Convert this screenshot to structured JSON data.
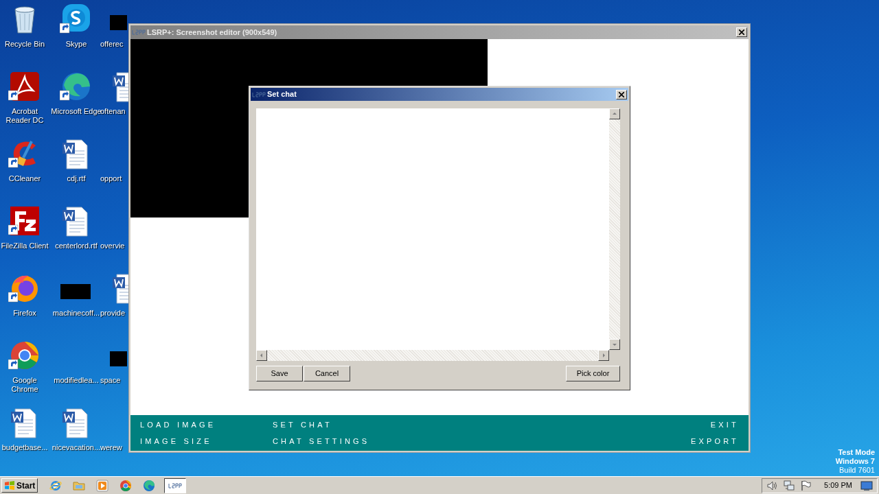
{
  "desktop": {
    "columns": [
      [
        {
          "label": "Recycle Bin",
          "kind": "recycle",
          "shortcut": false
        },
        {
          "label": "Acrobat Reader DC",
          "kind": "pdf",
          "shortcut": true
        },
        {
          "label": "CCleaner",
          "kind": "ccleaner",
          "shortcut": true
        },
        {
          "label": "FileZilla Client",
          "kind": "filezilla",
          "shortcut": true
        },
        {
          "label": "Firefox",
          "kind": "firefox",
          "shortcut": true
        },
        {
          "label": "Google Chrome",
          "kind": "chrome",
          "shortcut": true
        },
        {
          "label": "budgetbase...",
          "kind": "word",
          "shortcut": false
        }
      ],
      [
        {
          "label": "Skype",
          "kind": "skype",
          "shortcut": true
        },
        {
          "label": "Microsoft Edge",
          "kind": "edge",
          "shortcut": true
        },
        {
          "label": "cdj.rtf",
          "kind": "word",
          "shortcut": false
        },
        {
          "label": "centerlord.rtf",
          "kind": "word",
          "shortcut": false
        },
        {
          "label": "machinecoff...",
          "kind": "black",
          "shortcut": false
        },
        {
          "label": "modifiedlea...",
          "kind": "blank"
        },
        {
          "label": "nicevacation...",
          "kind": "word",
          "shortcut": false
        }
      ],
      [
        {
          "label": "offerec",
          "kind": "black",
          "shortcut": false
        },
        {
          "label": "oftenan",
          "kind": "word",
          "shortcut": false
        },
        {
          "label": "opport",
          "kind": "blank"
        },
        {
          "label": "overvie",
          "kind": "blank"
        },
        {
          "label": "provide",
          "kind": "word",
          "shortcut": false
        },
        {
          "label": "space",
          "kind": "black",
          "shortcut": false
        },
        {
          "label": "werew",
          "kind": "blank"
        }
      ]
    ]
  },
  "system_info": [
    {
      "text": "Test Mode",
      "bold": true
    },
    {
      "text": "Windows 7",
      "bold": true
    },
    {
      "text": "Build 7601",
      "bold": false
    }
  ],
  "editor_window": {
    "title": "LSRP+: Screenshot editor (900x549)",
    "menu_left": [
      [
        "LOAD IMAGE",
        "IMAGE SIZE"
      ],
      [
        "SET CHAT",
        "CHAT SETTINGS"
      ]
    ],
    "menu_right": [
      "EXIT",
      "EXPORT"
    ]
  },
  "dialog": {
    "title": "Set chat",
    "buttons_left": [
      "Save",
      "Cancel"
    ],
    "buttons_right": [
      "Pick color"
    ]
  },
  "taskbar": {
    "start": "Start",
    "quick_launch": [
      {
        "kind": "ie"
      },
      {
        "kind": "folder"
      },
      {
        "kind": "media"
      },
      {
        "kind": "chrome"
      },
      {
        "kind": "edge"
      }
    ],
    "tasks": [
      {
        "kind": "lsrp",
        "selected": true
      }
    ],
    "tray": [
      {
        "kind": "volume"
      },
      {
        "kind": "network"
      },
      {
        "kind": "flag"
      }
    ],
    "clock": "5:09 PM"
  }
}
